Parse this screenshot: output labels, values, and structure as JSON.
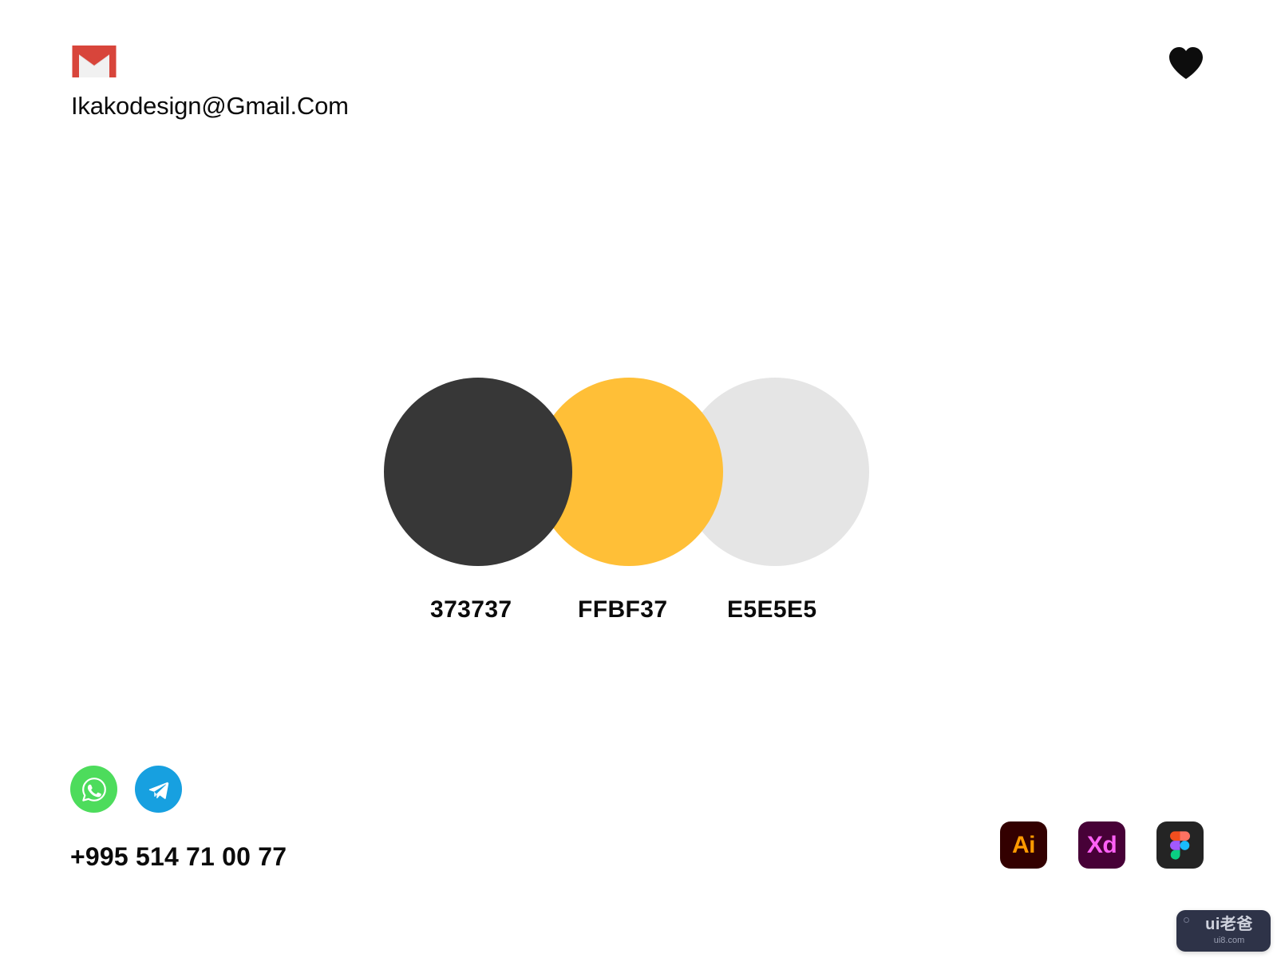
{
  "page": {
    "background": "#FFFFFF"
  },
  "contact": {
    "email_icon": "gmail-icon",
    "email": "Ikakodesign@Gmail.Com",
    "phone": "+995 514 71 00 77"
  },
  "favorite": {
    "icon": "heart-icon",
    "color": "#0D0D0D"
  },
  "palette": {
    "swatches": [
      {
        "hex_label": "373737",
        "color": "#373737"
      },
      {
        "hex_label": "FFBF37",
        "color": "#FFBF37"
      },
      {
        "hex_label": "E5E5E5",
        "color": "#E5E5E5"
      }
    ]
  },
  "social": [
    {
      "name": "whatsapp-icon",
      "color": "#4DDC5C"
    },
    {
      "name": "telegram-icon",
      "color": "#17A0E0"
    }
  ],
  "apps": [
    {
      "name": "adobe-illustrator-icon",
      "label": "Ai",
      "bg": "#330000",
      "fg": "#FF9A00"
    },
    {
      "name": "adobe-xd-icon",
      "label": "Xd",
      "bg": "#470137",
      "fg": "#FF61F6"
    },
    {
      "name": "figma-icon",
      "label": "",
      "bg": "#242424",
      "fg": "#FFFFFF"
    }
  ],
  "watermark": {
    "title": "ui老爸",
    "subtitle": "ui8.com"
  }
}
